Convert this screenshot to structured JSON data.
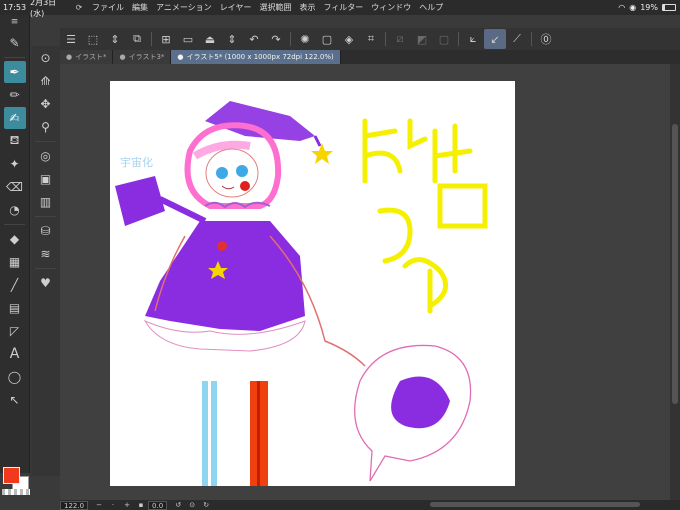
{
  "status": {
    "time": "17:53",
    "date": "2月3日(水)",
    "battery_percent": "19%",
    "battery_level": 0.19
  },
  "menubar": {
    "items": [
      "ファイル",
      "編集",
      "アニメーション",
      "レイヤー",
      "選択範囲",
      "表示",
      "フィルター",
      "ウィンドウ",
      "ヘルプ"
    ]
  },
  "tabs": [
    {
      "label": "イラスト*"
    },
    {
      "label": "イラスト3*"
    },
    {
      "label": "イラスト5* (1000 x 1000px 72dpi 122.0%)"
    }
  ],
  "bottombar": {
    "zoom": "122.0",
    "rotation": "0.0"
  },
  "colors": {
    "main": "#f03a1e",
    "sub": "#ffffff",
    "active_tool": "#3d8c9e",
    "active_tab": "#5a6f8c"
  },
  "icons": {
    "commands": [
      "menu-icon",
      "new-file-icon",
      "stepper-icon",
      "open-icon",
      "save-icon",
      "clear-icon",
      "undo-icon",
      "redo-icon",
      "transform-icon",
      "fill-icon",
      "crop-icon",
      "ruler-icon",
      "brush-icon",
      "pen-icon",
      "help-icon"
    ]
  }
}
